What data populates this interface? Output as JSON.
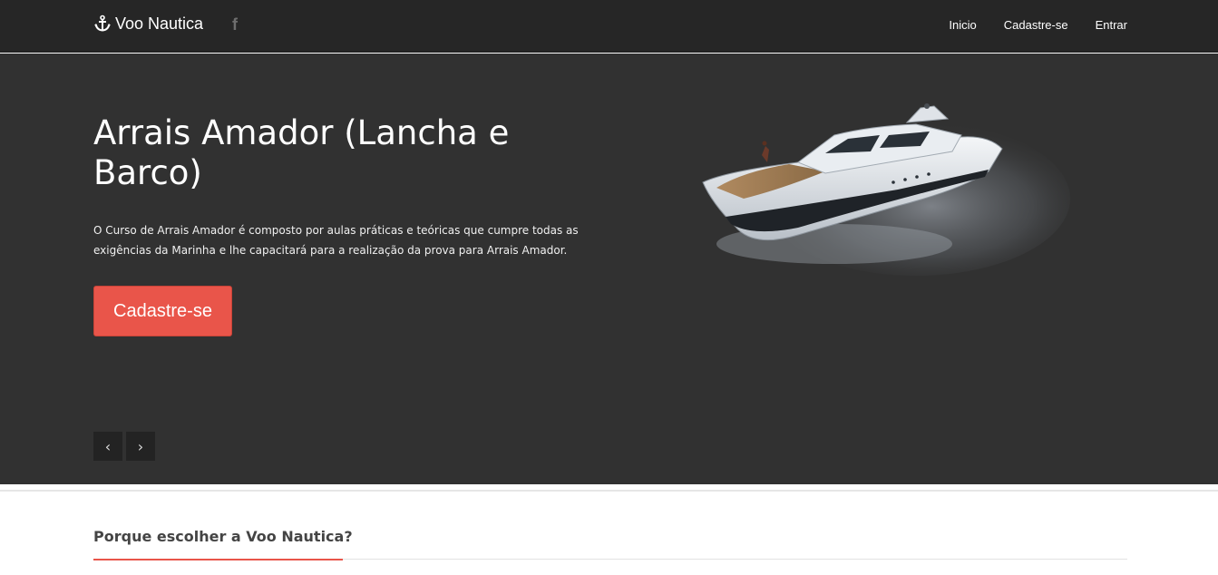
{
  "navbar": {
    "brand_label": "Voo Nautica",
    "facebook_glyph": "f",
    "links": [
      "Inicio",
      "Cadastre-se",
      "Entrar"
    ]
  },
  "hero": {
    "title": "Arrais Amador (Lancha e Barco)",
    "description": "O Curso de Arrais Amador é composto por aulas práticas e teóricas que cumpre todas as exigências da Marinha e lhe capacitará para a realização da prova para Arrais Amador.",
    "cta_label": "Cadastre-se",
    "prev_glyph": "‹",
    "next_glyph": "›"
  },
  "section": {
    "title": "Porque escolher a Voo Nautica?"
  },
  "icons": {
    "brand": "anchor-icon",
    "social": "facebook-icon",
    "prev": "chevron-left-icon",
    "next": "chevron-right-icon"
  },
  "colors": {
    "navbar_bg": "#262626",
    "hero_bg": "#313131",
    "accent": "#e9554a"
  }
}
